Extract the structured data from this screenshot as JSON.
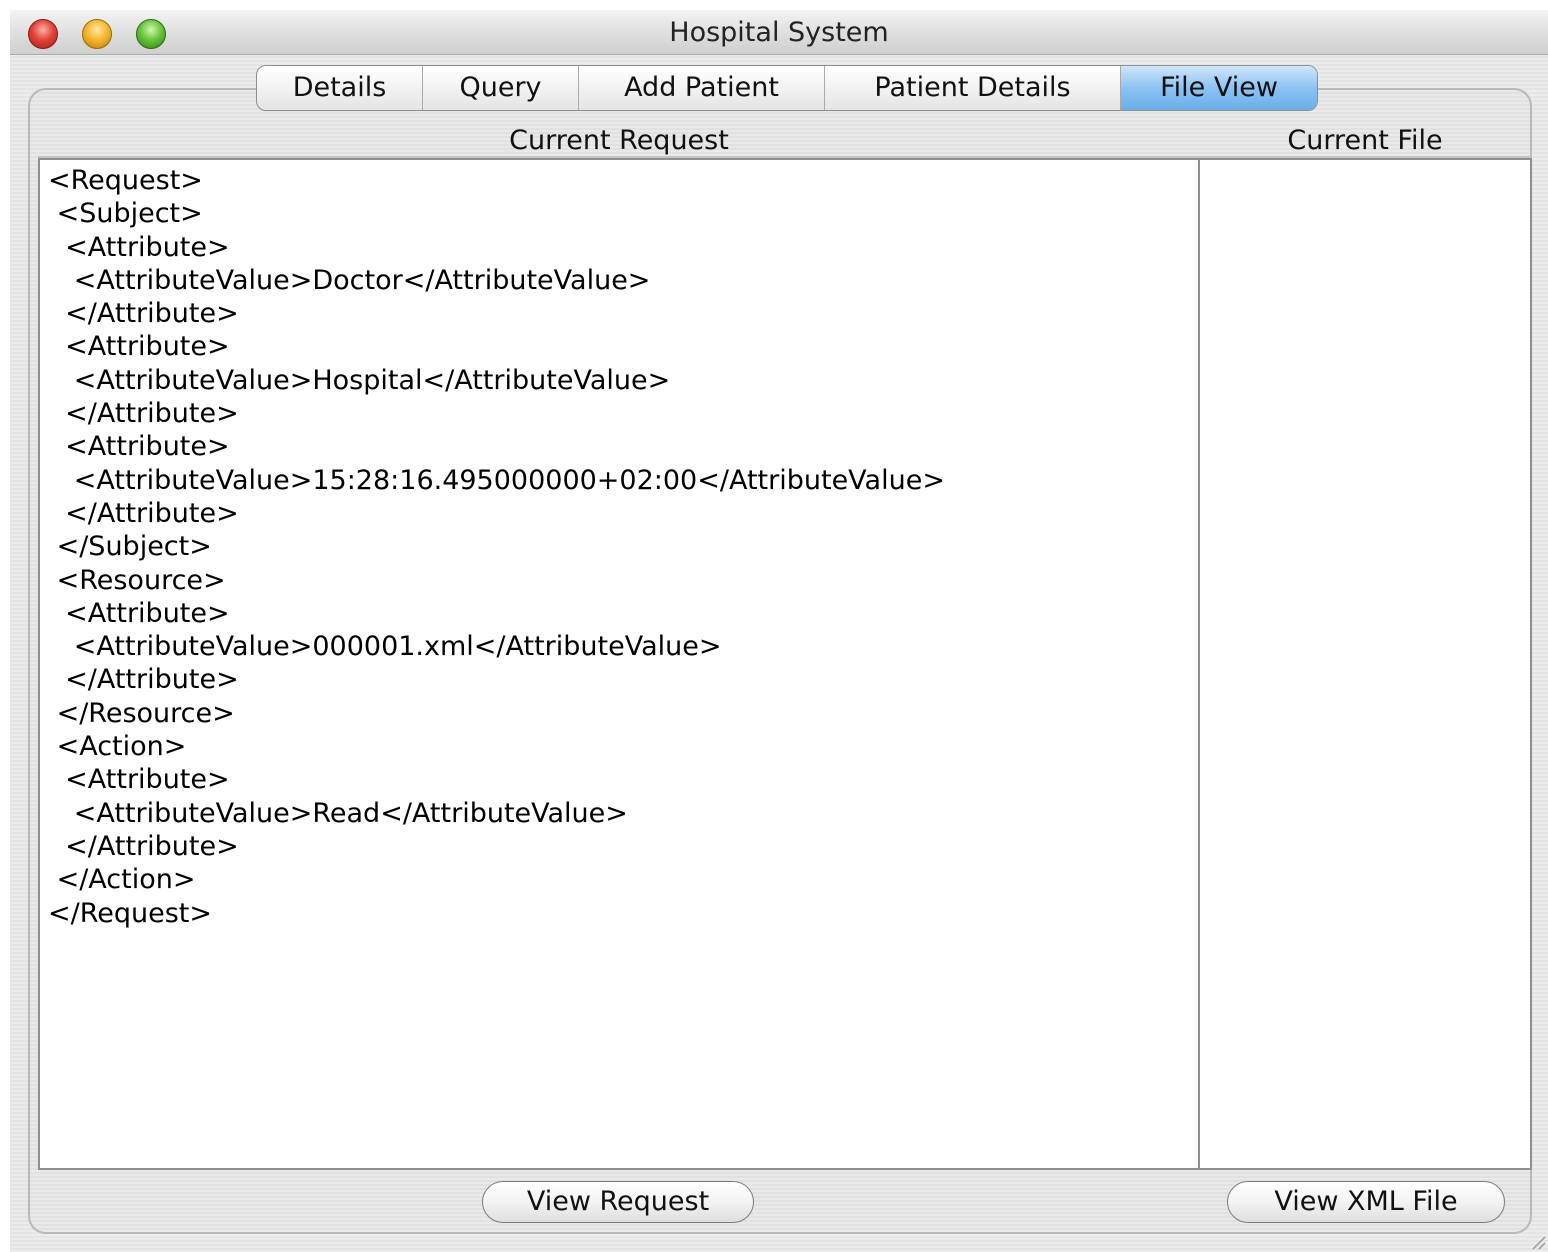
{
  "window": {
    "title": "Hospital System"
  },
  "tabs": [
    {
      "label": "Details",
      "active": false
    },
    {
      "label": "Query",
      "active": false
    },
    {
      "label": "Add Patient",
      "active": false
    },
    {
      "label": "Patient Details",
      "active": false
    },
    {
      "label": "File View",
      "active": true
    }
  ],
  "file_view": {
    "request_header": "Current Request",
    "file_header": "Current File",
    "request_xml": "<Request>\n <Subject>\n  <Attribute>\n   <AttributeValue>Doctor</AttributeValue>\n  </Attribute>\n  <Attribute>\n   <AttributeValue>Hospital</AttributeValue>\n  </Attribute>\n  <Attribute>\n   <AttributeValue>15:28:16.495000000+02:00</AttributeValue>\n  </Attribute>\n </Subject>\n <Resource>\n  <Attribute>\n   <AttributeValue>000001.xml</AttributeValue>\n  </Attribute>\n </Resource>\n <Action>\n  <Attribute>\n   <AttributeValue>Read</AttributeValue>\n  </Attribute>\n </Action>\n</Request>",
    "file_content": "",
    "view_request_label": "View Request",
    "view_xml_file_label": "View XML File"
  },
  "colors": {
    "active_tab": "#8dc2f3",
    "close": "#e0443a",
    "minimize": "#f5b731",
    "zoom": "#6ac53c"
  }
}
